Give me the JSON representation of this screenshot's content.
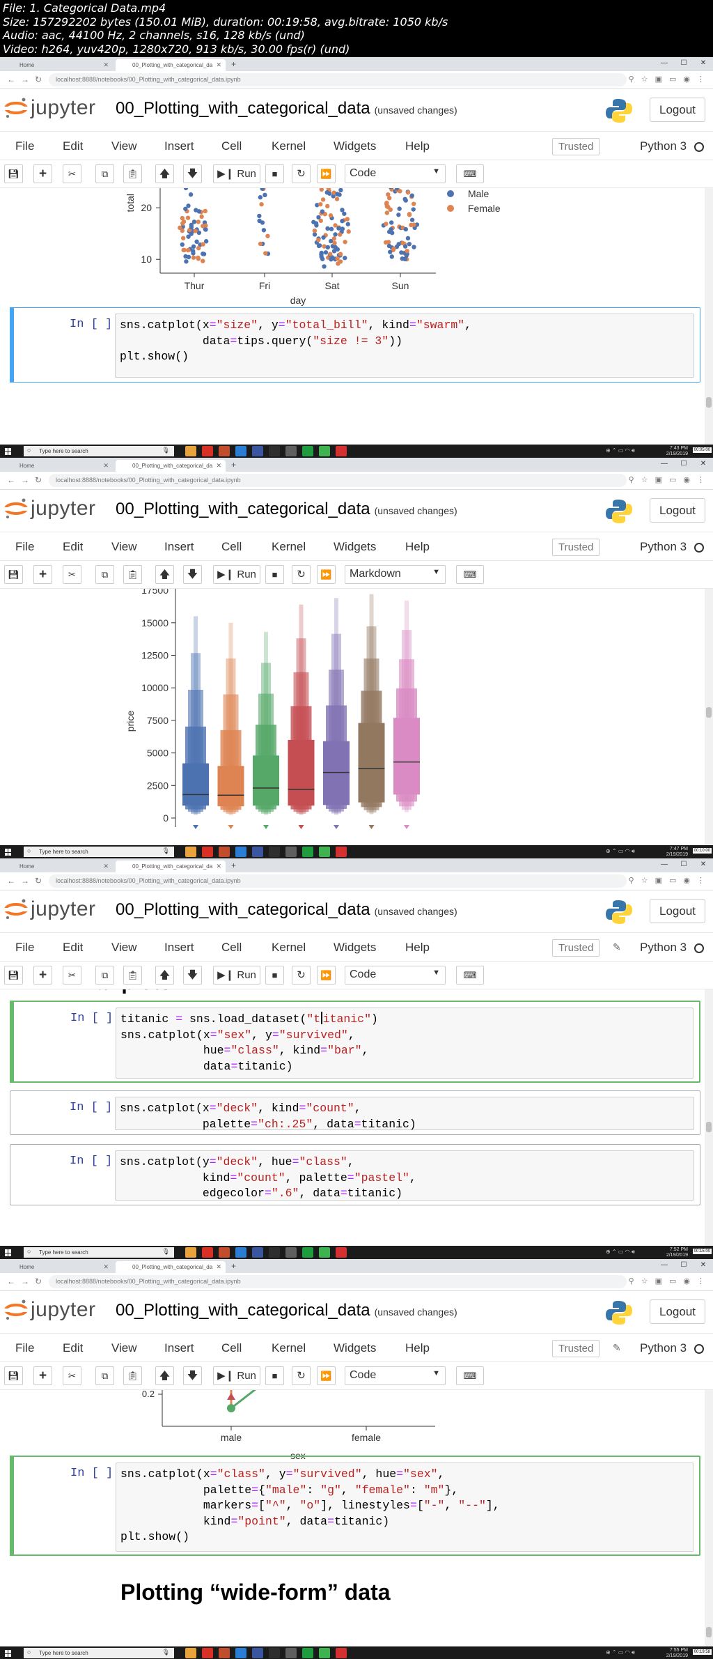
{
  "file_info": [
    "File: 1. Categorical Data.mp4",
    "Size: 157292202 bytes (150.01 MiB), duration: 00:19:58, avg.bitrate: 1050 kb/s",
    "Audio: aac, 44100 Hz, 2 channels, s16, 128 kb/s (und)",
    "Video: h264, yuv420p, 1280x720, 913 kb/s, 30.00 fps(r) (und)"
  ],
  "browser": {
    "tab_home": "Home",
    "tab_notebook": "00_Plotting_with_categorical_da",
    "url": "localhost:8888/notebooks/00_Plotting_with_categorical_data.ipynb"
  },
  "jupyter": {
    "logo_text": "jupyter",
    "notebook_name": "00_Plotting_with_categorical_data",
    "unsaved": "(unsaved changes)",
    "logout": "Logout",
    "menu": [
      "File",
      "Edit",
      "View",
      "Insert",
      "Cell",
      "Kernel",
      "Widgets",
      "Help"
    ],
    "trusted": "Trusted",
    "kernel_name": "Python 3",
    "run_label": "Run"
  },
  "taskbar": {
    "search_placeholder": "Type here to search",
    "app_colors": [
      "#e8a33c",
      "#d93025",
      "#c24d2c",
      "#2b7cd3",
      "#3b56a0",
      "#2e2e2e",
      "#5f5f5f",
      "#1f9c3d",
      "#3fb34f",
      "#d43030"
    ]
  },
  "frames": [
    {
      "cell_type": "Code",
      "tray_time": "7:43 PM",
      "tray_date": "2/19/2019",
      "timestamp": "00:05:00",
      "prompt": "In [ ]:",
      "code_lines": [
        "sns.catplot(x=\"size\", y=\"total_bill\", kind=\"swarm\",",
        "            data=tips.query(\"size != 3\"))",
        "plt.show()"
      ]
    },
    {
      "cell_type": "Markdown",
      "tray_time": "7:47 PM",
      "tray_date": "2/19/2019",
      "timestamp": "00:10:00",
      "chart_ylabel": "price"
    },
    {
      "cell_type": "Code",
      "tray_time": "7:52 PM",
      "tray_date": "2/19/2019",
      "timestamp": "00:15:00",
      "cells": [
        {
          "prompt": "In [ ]:",
          "code_lines": [
            "titanic = sns.load_dataset(\"titanic\")",
            "sns.catplot(x=\"sex\", y=\"survived\",",
            "            hue=\"class\", kind=\"bar\",",
            "            data=titanic)"
          ]
        },
        {
          "prompt": "In [ ]:",
          "code_lines": [
            "sns.catplot(x=\"deck\", kind=\"count\",",
            "            palette=\"ch:.25\", data=titanic)"
          ]
        },
        {
          "prompt": "In [ ]:",
          "code_lines": [
            "sns.catplot(y=\"deck\", hue=\"class\",",
            "            kind=\"count\", palette=\"pastel\",",
            "            edgecolor=\".6\", data=titanic)"
          ]
        }
      ]
    },
    {
      "cell_type": "Code",
      "tray_time": "7:55 PM",
      "tray_date": "2/19/2019",
      "timestamp": "00:19:58",
      "prompt": "In [ ]:",
      "code_lines": [
        "sns.catplot(x=\"class\", y=\"survived\", hue=\"sex\",",
        "            palette={\"male\": \"g\", \"female\": \"m\"},",
        "            markers=[\"^\", \"o\"], linestyles=[\"-\", \"--\"],",
        "            kind=\"point\", data=titanic)",
        "plt.show()"
      ],
      "heading": "Plotting “wide-form” data"
    }
  ],
  "chart_data": [
    {
      "type": "scatter",
      "subtype": "swarm",
      "xlabel": "day",
      "ylabel": "total",
      "categories": [
        "Thur",
        "Fri",
        "Sat",
        "Sun"
      ],
      "y_ticks": [
        10,
        20
      ],
      "legend": [
        {
          "name": "Male",
          "color": "#4c72b0"
        },
        {
          "name": "Female",
          "color": "#dd8452"
        }
      ],
      "legend_position": "top-right",
      "partially_visible": true
    },
    {
      "type": "boxen",
      "ylabel": "price",
      "y_ticks": [
        0,
        2500,
        5000,
        7500,
        10000,
        12500,
        15000
      ],
      "ylim": [
        0,
        17500
      ],
      "series": [
        {
          "color": "#4c72b0",
          "median": 1800,
          "q1": 950,
          "q3": 4200,
          "max": 15500
        },
        {
          "color": "#dd8452",
          "median": 1750,
          "q1": 900,
          "q3": 4000,
          "max": 15000
        },
        {
          "color": "#55a868",
          "median": 2300,
          "q1": 950,
          "q3": 4800,
          "max": 14300
        },
        {
          "color": "#c44e52",
          "median": 2200,
          "q1": 950,
          "q3": 6000,
          "max": 16400
        },
        {
          "color": "#8172b3",
          "median": 3500,
          "q1": 1000,
          "q3": 5900,
          "max": 16900
        },
        {
          "color": "#937860",
          "median": 3800,
          "q1": 1200,
          "q3": 7300,
          "max": 17200
        },
        {
          "color": "#da8bc3",
          "median": 4300,
          "q1": 1800,
          "q3": 7700,
          "max": 16700
        }
      ],
      "partially_visible": true
    },
    {
      "type": "line",
      "subtype": "point",
      "xlabel": "sex",
      "categories": [
        "male",
        "female"
      ],
      "y_ticks": [
        0.2
      ],
      "partially_visible": true
    }
  ]
}
